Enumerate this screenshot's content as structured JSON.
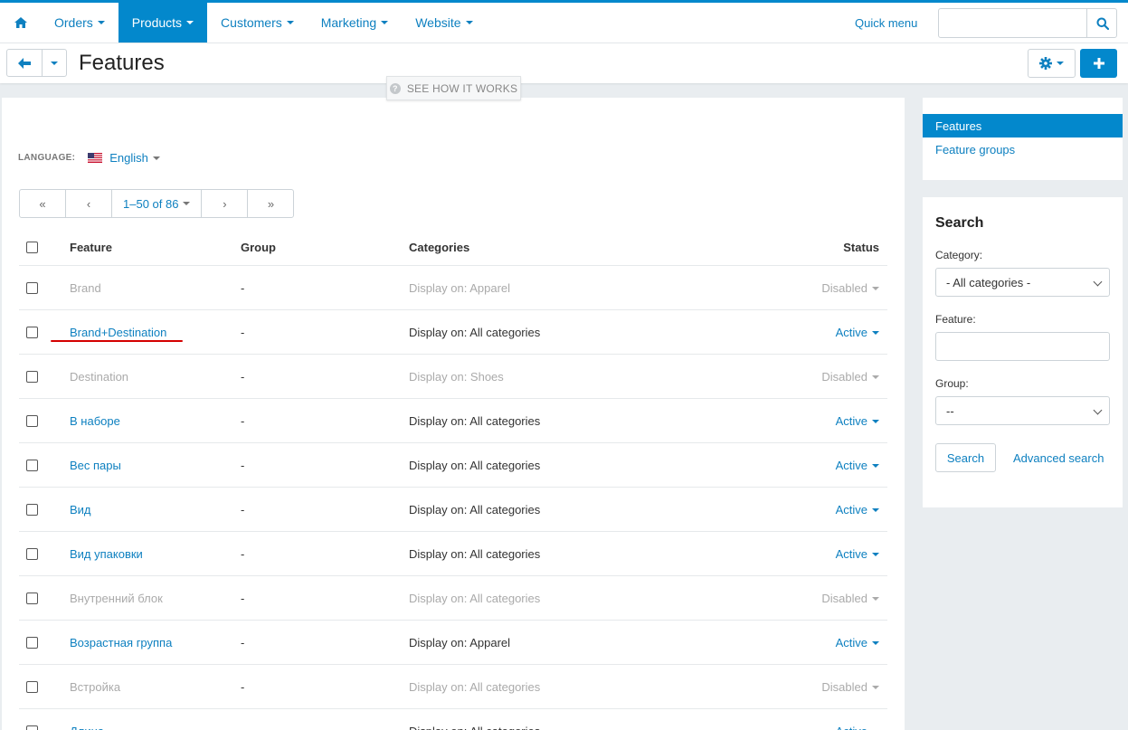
{
  "nav": {
    "items": [
      {
        "label": "Orders"
      },
      {
        "label": "Products"
      },
      {
        "label": "Customers"
      },
      {
        "label": "Marketing"
      },
      {
        "label": "Website"
      }
    ],
    "quick_menu": "Quick menu",
    "search_value": ""
  },
  "header": {
    "title": "Features",
    "see_how": "SEE HOW IT WORKS"
  },
  "language": {
    "label": "LANGUAGE:",
    "value": "English"
  },
  "pager": {
    "range": "1–50 of 86"
  },
  "table": {
    "headers": {
      "feature": "Feature",
      "group": "Group",
      "categories": "Categories",
      "status": "Status"
    },
    "rows": [
      {
        "feature": "Brand",
        "group": "-",
        "categories": "Display on: Apparel",
        "status": "Disabled"
      },
      {
        "feature": "Brand+Destination",
        "group": "-",
        "categories": "Display on: All categories",
        "status": "Active"
      },
      {
        "feature": "Destination",
        "group": "-",
        "categories": "Display on: Shoes",
        "status": "Disabled"
      },
      {
        "feature": "В наборе",
        "group": "-",
        "categories": "Display on: All categories",
        "status": "Active"
      },
      {
        "feature": "Вес пары",
        "group": "-",
        "categories": "Display on: All categories",
        "status": "Active"
      },
      {
        "feature": "Вид",
        "group": "-",
        "categories": "Display on: All categories",
        "status": "Active"
      },
      {
        "feature": "Вид упаковки",
        "group": "-",
        "categories": "Display on: All categories",
        "status": "Active"
      },
      {
        "feature": "Внутренний блок",
        "group": "-",
        "categories": "Display on: All categories",
        "status": "Disabled"
      },
      {
        "feature": "Возрастная группа",
        "group": "-",
        "categories": "Display on: Apparel",
        "status": "Active"
      },
      {
        "feature": "Встройка",
        "group": "-",
        "categories": "Display on: All categories",
        "status": "Disabled"
      },
      {
        "feature": "Длина",
        "group": "-",
        "categories": "Display on: All categories",
        "status": "Active"
      }
    ]
  },
  "sidebar": {
    "items": [
      {
        "label": "Features"
      },
      {
        "label": "Feature groups"
      }
    ]
  },
  "search_panel": {
    "title": "Search",
    "category_label": "Category:",
    "category_value": "- All categories -",
    "feature_label": "Feature:",
    "feature_value": "",
    "group_label": "Group:",
    "group_value": "--",
    "search_button": "Search",
    "advanced_link": "Advanced search"
  },
  "colors": {
    "accent": "#0388cc",
    "link": "#0e80c0",
    "disabled": "#aaaaaa",
    "annotation": "#d40000"
  }
}
